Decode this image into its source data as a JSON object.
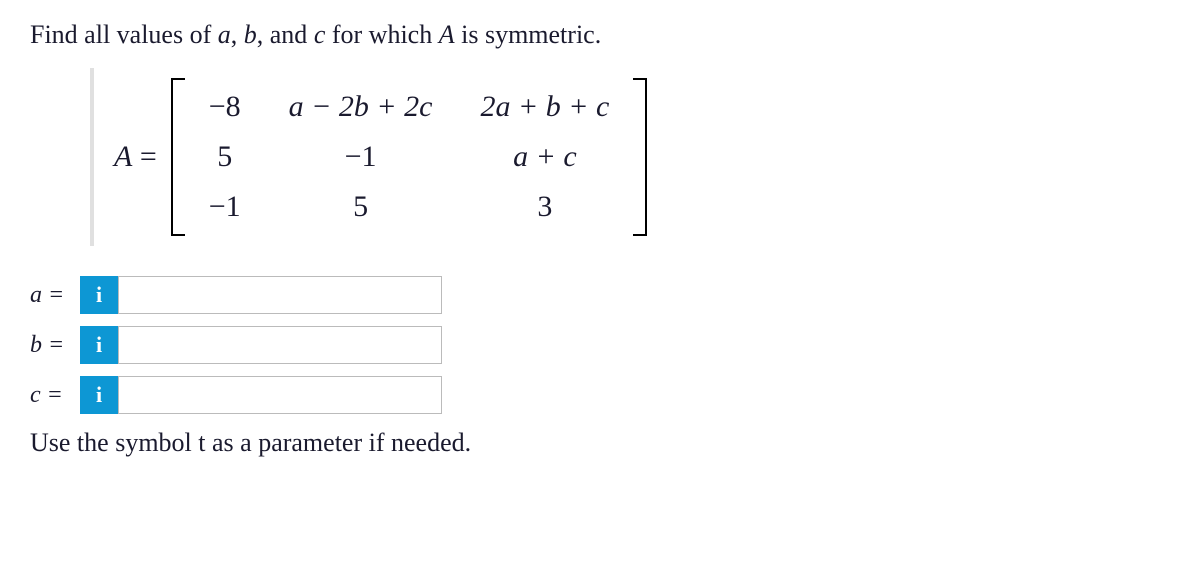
{
  "question": {
    "pre": "Find all values of ",
    "a": "a",
    "sep1": ", ",
    "b": "b",
    "sep2": ", and ",
    "c": "c",
    "mid": " for which ",
    "A": "A",
    "post": " is symmetric."
  },
  "matrix": {
    "lhs_A": "A",
    "lhs_eq": " = ",
    "cells": {
      "r0c0": "−8",
      "r0c1": "a − 2b + 2c",
      "r0c2": "2a + b + c",
      "r1c0": "5",
      "r1c1": "−1",
      "r1c2": "a + c",
      "r2c0": "−1",
      "r2c1": "5",
      "r2c2": "3"
    }
  },
  "answers": {
    "a_label": "a =",
    "b_label": "b =",
    "c_label": "c =",
    "a_value": "",
    "b_value": "",
    "c_value": "",
    "info_glyph": "i"
  },
  "hint": {
    "pre": "Use the symbol ",
    "t": "t",
    "post": " as a parameter if needed."
  }
}
